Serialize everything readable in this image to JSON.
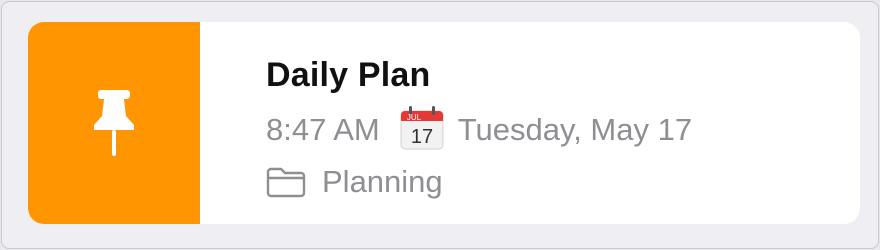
{
  "note": {
    "title": "Daily Plan",
    "time": "8:47 AM",
    "date": "Tuesday, May 17",
    "folder": "Planning",
    "calendar_month": "JUL",
    "calendar_day": "17",
    "pin_icon": "pin-icon",
    "calendar_icon": "calendar-icon",
    "folder_icon": "folder-icon",
    "accent_color": "#ff9500",
    "secondary_text_color": "#8e8e93"
  }
}
